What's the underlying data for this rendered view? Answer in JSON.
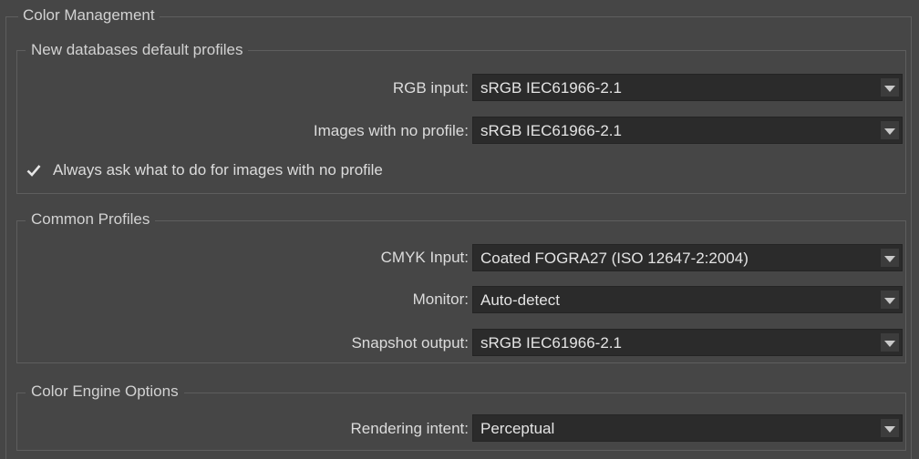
{
  "panel": {
    "title": "Color Management"
  },
  "new_db": {
    "title": "New databases default profiles",
    "rgb_input": {
      "label": "RGB input:",
      "value": "sRGB IEC61966-2.1"
    },
    "no_profile": {
      "label": "Images with no profile:",
      "value": "sRGB IEC61966-2.1"
    },
    "always_ask": {
      "label": "Always ask what to do for images with no profile",
      "checked": true
    }
  },
  "common": {
    "title": "Common Profiles",
    "cmyk_input": {
      "label": "CMYK Input:",
      "value": "Coated FOGRA27 (ISO 12647-2:2004)"
    },
    "monitor": {
      "label": "Monitor:",
      "value": "Auto-detect"
    },
    "snapshot": {
      "label": "Snapshot output:",
      "value": "sRGB IEC61966-2.1"
    }
  },
  "engine": {
    "title": "Color Engine Options",
    "rendering_intent": {
      "label": "Rendering intent:",
      "value": "Perceptual"
    }
  },
  "icons": {
    "dropdown": "chevron-down-icon",
    "check": "checkmark-icon"
  },
  "colors": {
    "background": "#464646",
    "field": "#2b2b2b",
    "border": "#5e5e5e",
    "text": "#dcdcdc"
  }
}
